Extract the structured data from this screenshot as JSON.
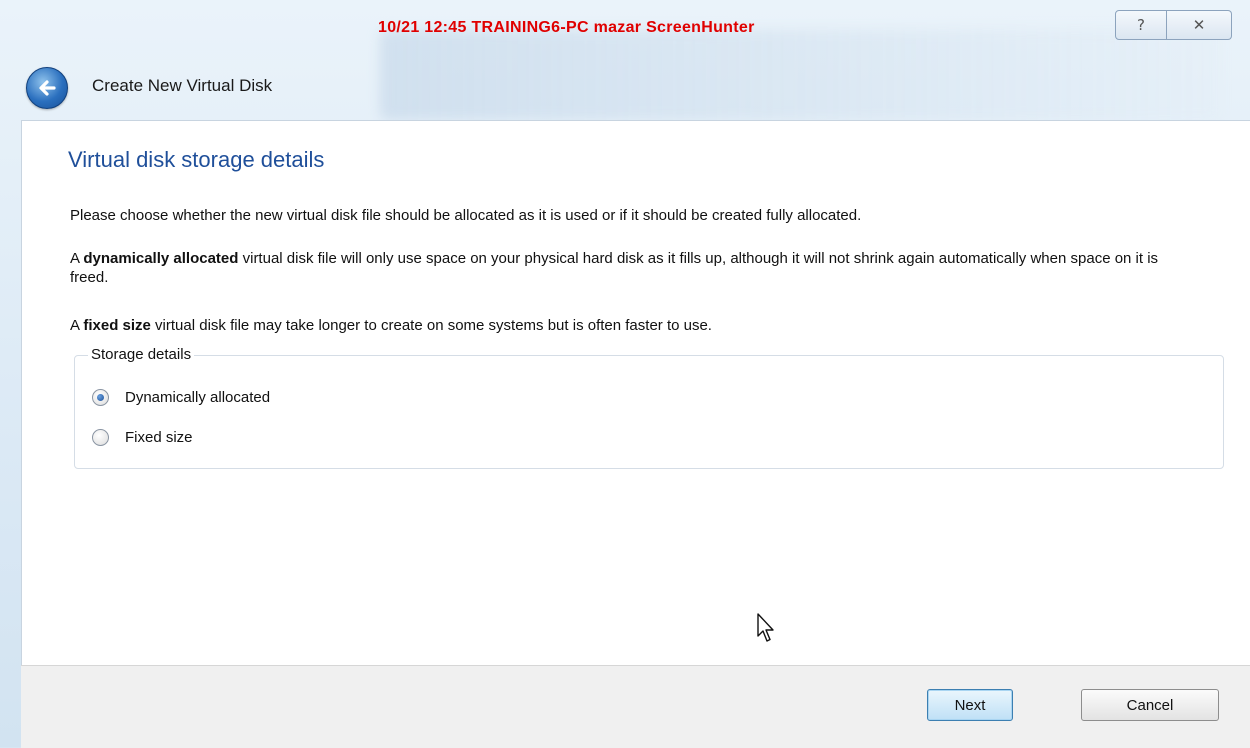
{
  "window": {
    "stamp_text": "10/21 12:45 TRAINING6-PC mazar ScreenHunter",
    "help_glyph": "?",
    "close_glyph": "✕"
  },
  "header": {
    "back_icon": "back-arrow-icon",
    "title": "Create New Virtual Disk"
  },
  "page": {
    "title": "Virtual disk storage details",
    "intro": "Please choose whether the new virtual disk file should be allocated as it is used or if it should be created fully allocated.",
    "dynamic_prefix": "A ",
    "dynamic_bold": "dynamically allocated",
    "dynamic_rest": " virtual disk file will only use space on your physical hard disk as it fills up, although it will not shrink again automatically when space on it is freed.",
    "fixed_prefix": "A ",
    "fixed_bold": "fixed size",
    "fixed_rest": " virtual disk file may take longer to create on some systems but is often faster to use."
  },
  "storage": {
    "legend": "Storage details",
    "options": [
      {
        "label": "Dynamically allocated",
        "selected": true
      },
      {
        "label": "Fixed size",
        "selected": false
      }
    ]
  },
  "footer": {
    "next_label": "Next",
    "cancel_label": "Cancel"
  },
  "colors": {
    "title_blue": "#1f4f9a",
    "stamp_red": "#e00000"
  }
}
